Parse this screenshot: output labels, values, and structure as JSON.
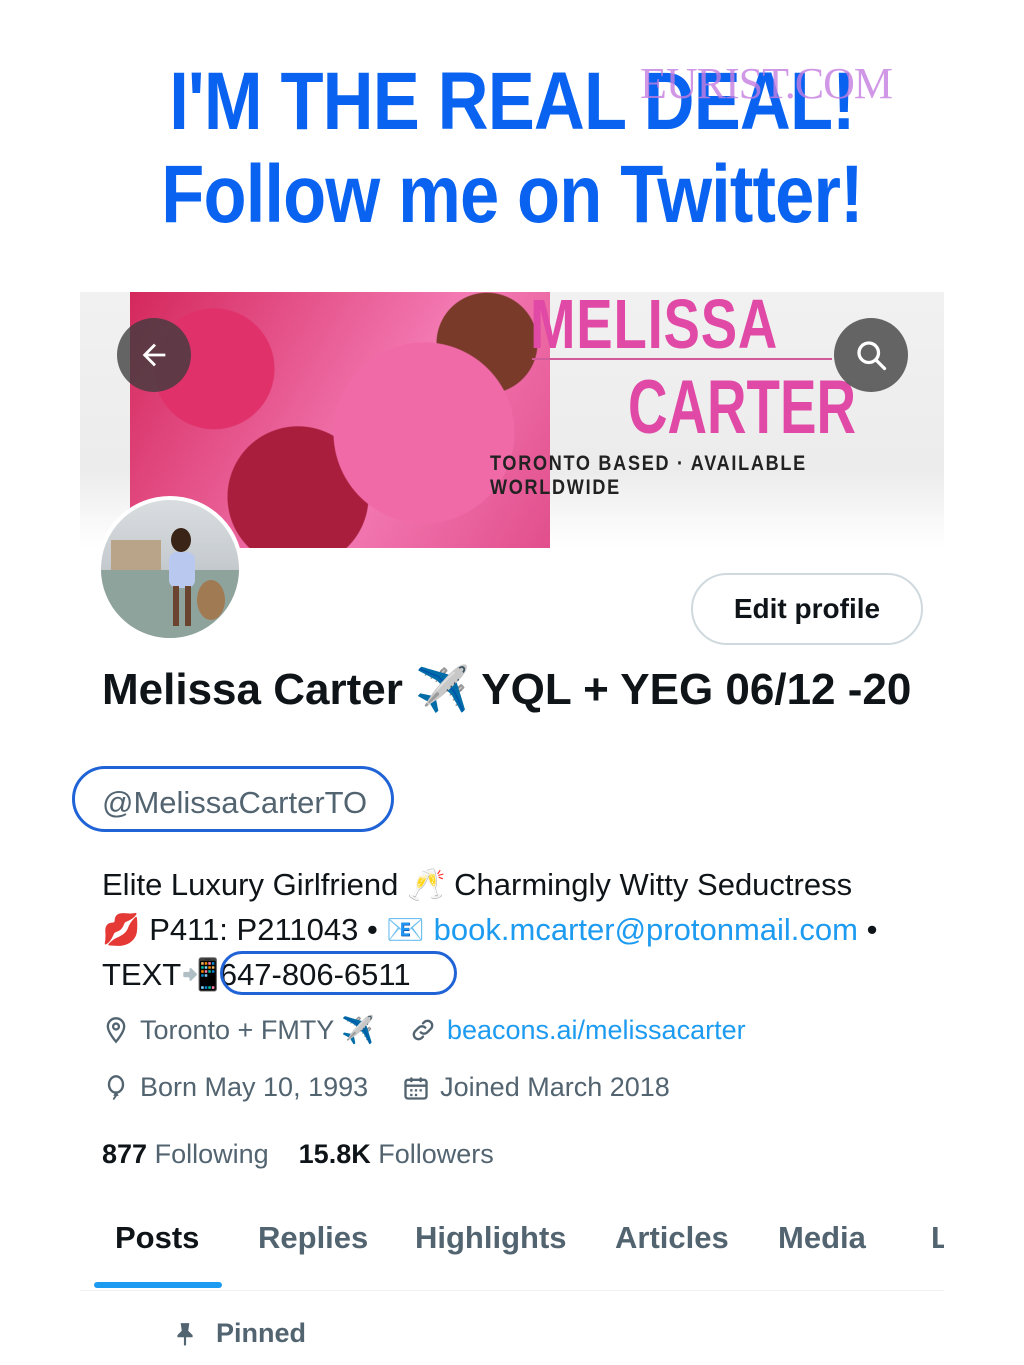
{
  "headline": {
    "line1": "I'M THE REAL DEAL!",
    "line2": "Follow me on Twitter!"
  },
  "watermark": "EURIST.COM",
  "banner": {
    "name_first": "MELISSA",
    "name_last": "CARTER",
    "tagline": "TORONTO BASED · AVAILABLE WORLDWIDE"
  },
  "profile": {
    "edit_button": "Edit profile",
    "display_name": "Melissa Carter ✈️ YQL + YEG 06/12 -20",
    "handle": "@MelissaCarterTO",
    "bio": {
      "line1": "Elite Luxury Girlfriend 🥂 Charmingly Witty Seductress",
      "line2_prefix": "💋 P411: P211043 • 📧",
      "email": "book.mcarter@protonmail.com",
      "line2_suffix": "•",
      "line3_prefix": "TEXT📲",
      "phone": "647-806-6511"
    },
    "location": "Toronto + FMTY ✈️",
    "website": "beacons.ai/melissacarter",
    "birthday": "Born May 10, 1993",
    "joined": "Joined March 2018",
    "following_count": "877",
    "following_label": "Following",
    "followers_count": "15.8K",
    "followers_label": "Followers"
  },
  "tabs": [
    "Posts",
    "Replies",
    "Highlights",
    "Articles",
    "Media",
    "L"
  ],
  "active_tab": "Posts",
  "pinned_label": "Pinned",
  "colors": {
    "headline_blue": "#0a63f0",
    "link_blue": "#1d9bf0",
    "annotation_blue": "#1f63d6",
    "banner_pink": "#e04aa6"
  },
  "icons": {
    "back": "arrow-left-icon",
    "search": "search-icon",
    "location": "location-pin-icon",
    "link": "link-icon",
    "birthday": "balloon-icon",
    "calendar": "calendar-icon",
    "pin": "pin-icon"
  }
}
